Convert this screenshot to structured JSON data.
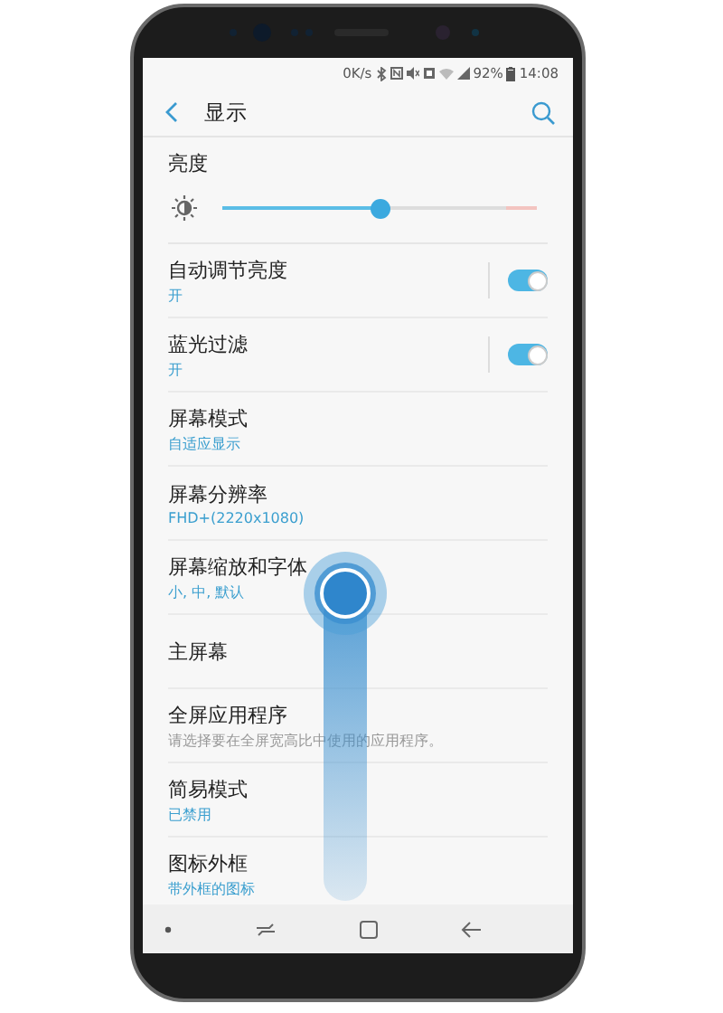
{
  "status_bar": {
    "speed": "0K/s",
    "battery": "92%",
    "time": "14:08"
  },
  "header": {
    "title": "显示"
  },
  "brightness": {
    "label": "亮度",
    "level": 0.5
  },
  "settings": [
    {
      "title": "自动调节亮度",
      "subtitle": "开",
      "subtitle_greyed": false,
      "kind": "switch",
      "on": true
    },
    {
      "title": "蓝光过滤",
      "subtitle": "开",
      "subtitle_greyed": false,
      "kind": "switch",
      "on": true
    },
    {
      "title": "屏幕模式",
      "subtitle": "自适应显示",
      "subtitle_greyed": false,
      "kind": "plain"
    },
    {
      "title": "屏幕分辨率",
      "subtitle": "FHD+(2220x1080)",
      "subtitle_greyed": false,
      "kind": "plain"
    },
    {
      "title": "屏幕缩放和字体",
      "subtitle": "小, 中, 默认",
      "subtitle_greyed": false,
      "kind": "plain"
    },
    {
      "title": "主屏幕",
      "kind": "plain"
    },
    {
      "title": "全屏应用程序",
      "subtitle": "请选择要在全屏宽高比中使用的应用程序。",
      "subtitle_greyed": true,
      "kind": "plain"
    },
    {
      "title": "简易模式",
      "subtitle": "已禁用",
      "subtitle_greyed": false,
      "kind": "plain"
    },
    {
      "title": "图标外框",
      "subtitle": "带外框的图标",
      "subtitle_greyed": false,
      "kind": "plain"
    }
  ]
}
